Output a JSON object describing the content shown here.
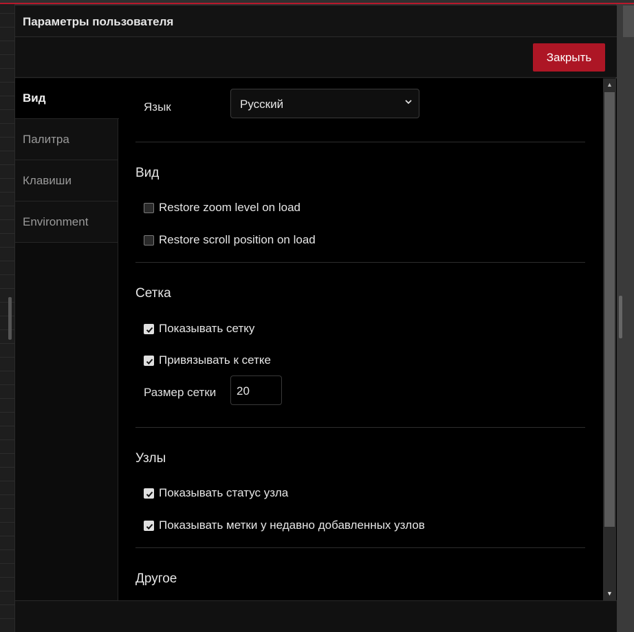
{
  "dialog": {
    "title": "Параметры пользователя",
    "close_label": "Закрыть"
  },
  "tabs": [
    {
      "label": "Вид",
      "active": true
    },
    {
      "label": "Палитра",
      "active": false
    },
    {
      "label": "Клавиши",
      "active": false
    },
    {
      "label": "Environment",
      "active": false
    }
  ],
  "language": {
    "label": "Язык",
    "selected": "Русский"
  },
  "sections": {
    "view": {
      "title": "Вид",
      "options": [
        {
          "label": "Restore zoom level on load",
          "checked": false
        },
        {
          "label": "Restore scroll position on load",
          "checked": false
        }
      ]
    },
    "grid": {
      "title": "Сетка",
      "options": [
        {
          "label": "Показывать сетку",
          "checked": true
        },
        {
          "label": "Привязывать к сетке",
          "checked": true
        }
      ],
      "size_label": "Размер сетки",
      "size_value": "20"
    },
    "nodes": {
      "title": "Узлы",
      "options": [
        {
          "label": "Показывать статус узла",
          "checked": true
        },
        {
          "label": "Показывать метки у недавно добавленных узлов",
          "checked": true
        }
      ]
    },
    "other": {
      "title": "Другое"
    }
  },
  "colors": {
    "accent": "#ad1625",
    "background": "#000000"
  }
}
